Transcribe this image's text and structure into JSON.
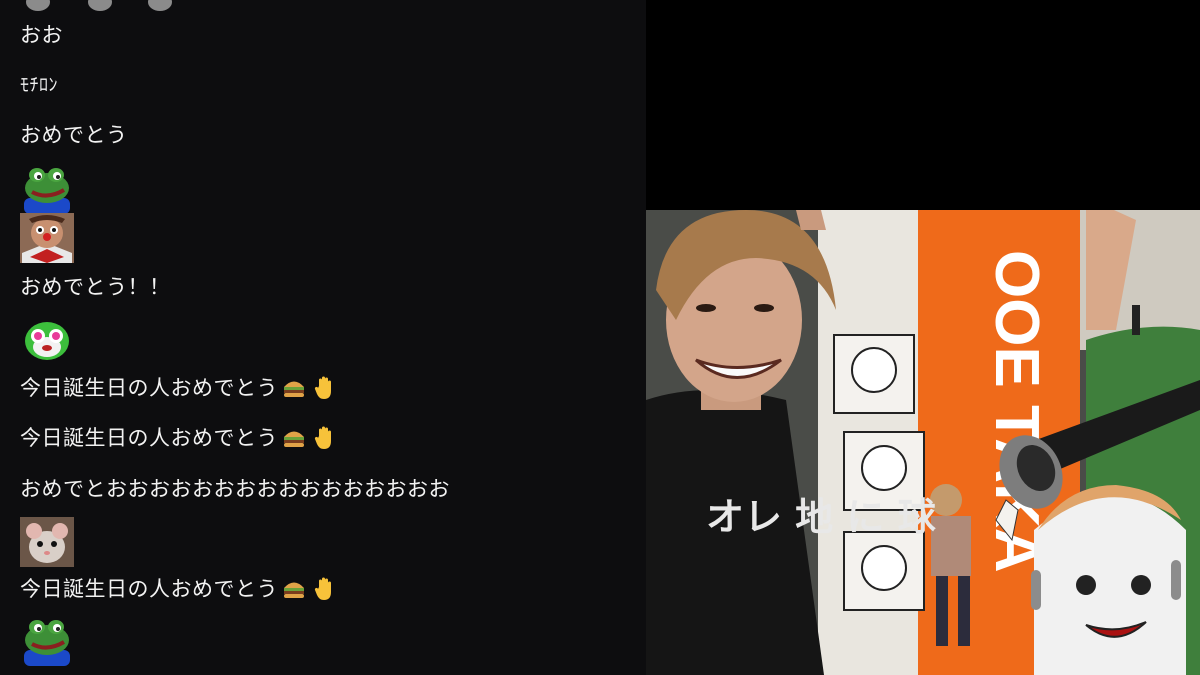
{
  "chat": {
    "messages": [
      {
        "kind": "text",
        "text": "おお"
      },
      {
        "kind": "text",
        "text": "ﾓﾁﾛﾝ"
      },
      {
        "kind": "text",
        "text": "おめでとう"
      },
      {
        "kind": "emote",
        "emote": "frog-emote"
      },
      {
        "kind": "emote",
        "emote": "clown-emote"
      },
      {
        "kind": "text",
        "text": "おめでとう！！"
      },
      {
        "kind": "emote",
        "emote": "green-creature-emote"
      },
      {
        "kind": "text",
        "text": "今日誕生日の人おめでとう",
        "emojis": [
          "hamburger-emoji",
          "raised-hand-emoji"
        ]
      },
      {
        "kind": "text",
        "text": "今日誕生日の人おめでとう",
        "emojis": [
          "hamburger-emoji",
          "raised-hand-emoji"
        ]
      },
      {
        "kind": "text",
        "text": "おめでとおおおおおおおおおおおおおおおお"
      },
      {
        "kind": "emote",
        "emote": "rat-emote"
      },
      {
        "kind": "text",
        "text": "今日誕生日の人おめでとう",
        "emojis": [
          "hamburger-emoji",
          "raised-hand-emoji"
        ]
      },
      {
        "kind": "emote",
        "emote": "frog-emote"
      }
    ]
  },
  "video": {
    "banner_text": "OOE TAKA",
    "shirt_text": "オレ 地 に 球"
  },
  "colors": {
    "chat_bg": "#0d0d0f",
    "chat_text": "#f2f2f2",
    "banner_orange": "#ef6a1a",
    "video_top": "#000000"
  }
}
